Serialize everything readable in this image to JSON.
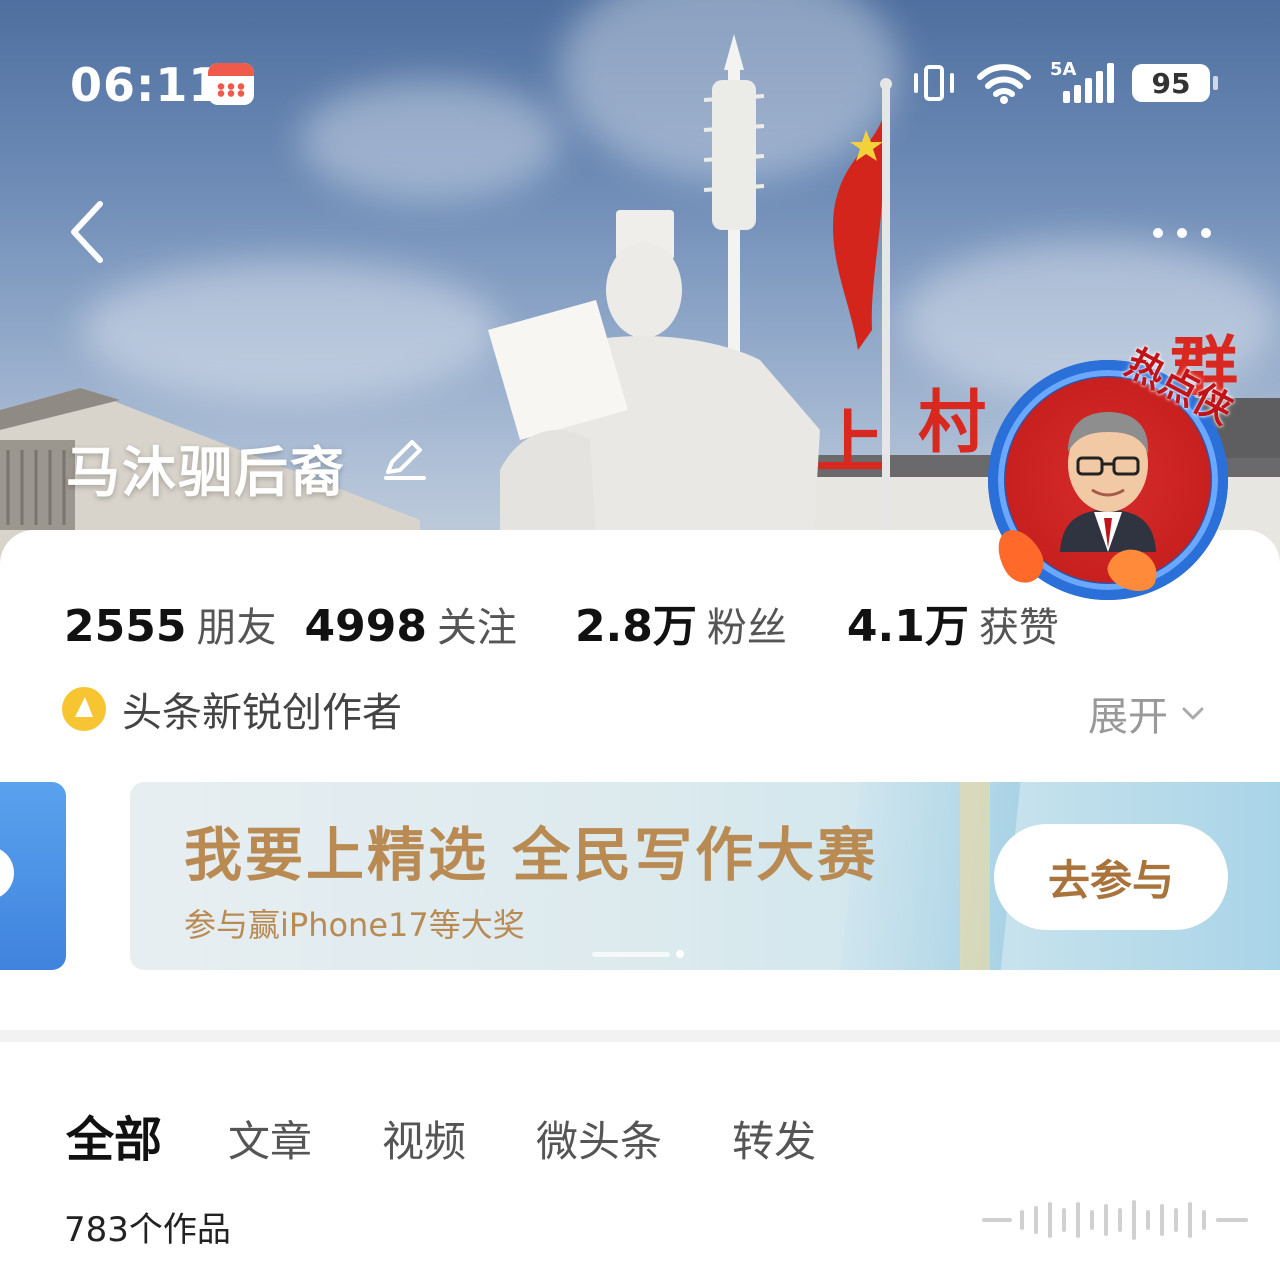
{
  "status_bar": {
    "time": "06:11",
    "network_label": "5A",
    "battery": "95"
  },
  "profile": {
    "name": "马沐驷后裔",
    "avatar_badge": "热点侠"
  },
  "stats": [
    {
      "value": "2555",
      "label": "朋友"
    },
    {
      "value": "4998",
      "label": "关注"
    },
    {
      "value": "2.8万",
      "label": "粉丝"
    },
    {
      "value": "4.1万",
      "label": "获赞"
    }
  ],
  "creator": {
    "title": "头条新锐创作者",
    "expand_label": "展开"
  },
  "banner": {
    "title": "我要上精选 全民写作大赛",
    "subtitle": "参与赢iPhone17等大奖",
    "button": "去参与"
  },
  "tabs": [
    {
      "label": "全部",
      "active": true
    },
    {
      "label": "文章"
    },
    {
      "label": "视频"
    },
    {
      "label": "微头条"
    },
    {
      "label": "转发"
    }
  ],
  "works_count": "783个作品",
  "colors": {
    "banner_text": "#b98a52",
    "creator_badge": "#f7c531",
    "avatar_ring": "#2b6fd9"
  }
}
